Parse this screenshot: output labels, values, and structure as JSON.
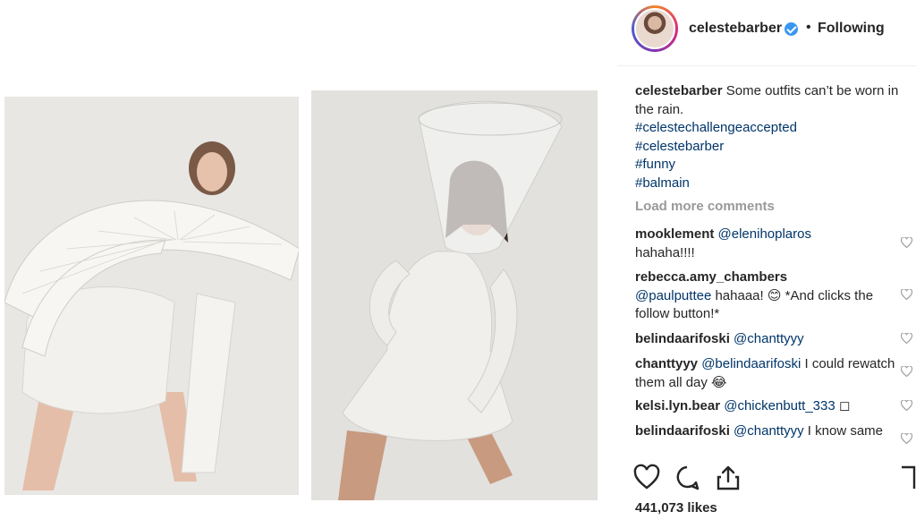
{
  "post": {
    "username": "celestebarber",
    "follow_status": "Following",
    "separator": "•",
    "caption": "Some outfits can’t be worn in the rain.",
    "hashtags": [
      "#celestechallengeaccepted",
      "#celestebarber",
      "#funny",
      "#balmain"
    ],
    "load_more": "Load more comments",
    "likes": "441,073 likes"
  },
  "comments": [
    {
      "user": "mooklement",
      "mention": "@elenihoplaros",
      "text": "hahaha!!!!"
    },
    {
      "user": "rebecca.amy_chambers",
      "mention": "@paulputtee",
      "text": " hahaaa! 😊  *And clicks the follow button!*"
    },
    {
      "user": "belindaarifoski",
      "mention": "@chanttyyy",
      "text": ""
    },
    {
      "user": "chanttyyy",
      "mention": "@belindaarifoski",
      "text": " I could rewatch them all day 😂"
    },
    {
      "user": "kelsi.lyn.bear",
      "mention": "@chickenbutt_333",
      "text": " ◻"
    },
    {
      "user": "belindaarifoski",
      "mention": "@chanttyyy",
      "text": " I know same"
    }
  ],
  "icons": {
    "heart": "heart-icon",
    "comment": "comment-icon",
    "share": "share-icon",
    "bookmark": "bookmark-icon",
    "verified": "verified-badge-icon"
  },
  "colors": {
    "link": "#003569",
    "verified": "#3897f0",
    "muted": "#999999"
  }
}
